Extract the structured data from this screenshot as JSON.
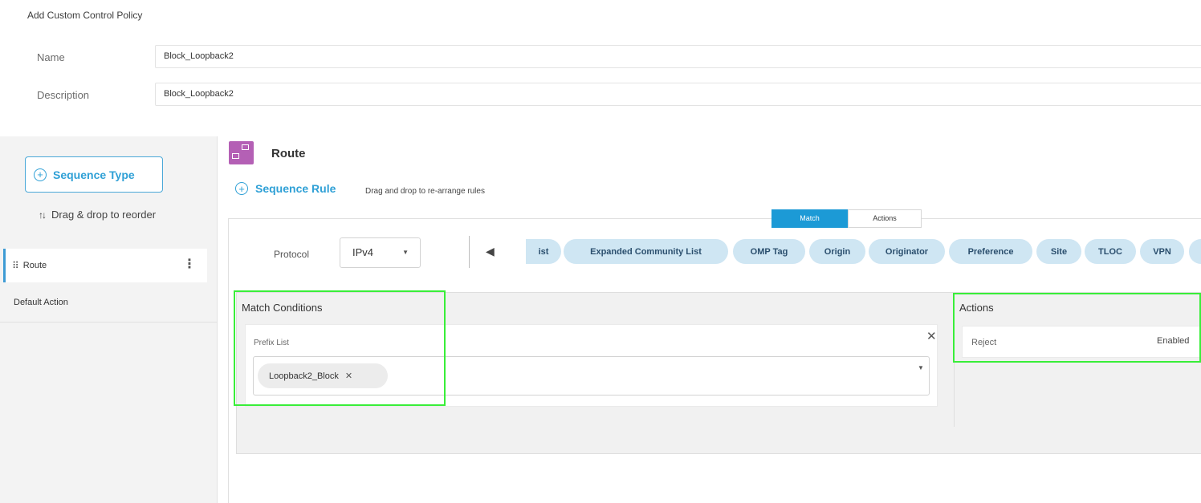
{
  "page": {
    "title": "Add Custom Control Policy"
  },
  "form": {
    "name_label": "Name",
    "name_value": "Block_Loopback2",
    "description_label": "Description",
    "description_value": "Block_Loopback2"
  },
  "sidebar": {
    "sequence_type_label": "Sequence Type",
    "drag_reorder_label": "Drag & drop to reorder",
    "items": [
      {
        "label": "Route"
      }
    ],
    "default_action_label": "Default Action"
  },
  "main": {
    "title": "Route",
    "sequence_rule_label": "Sequence Rule",
    "sequence_rule_hint": "Drag and drop to re-arrange rules",
    "tabs": [
      {
        "label": "Match"
      },
      {
        "label": "Actions"
      }
    ],
    "protocol_label": "Protocol",
    "protocol_value": "IPv4",
    "match_chips": [
      "ist",
      "Expanded Community List",
      "OMP Tag",
      "Origin",
      "Originator",
      "Preference",
      "Site",
      "TLOC",
      "VPN"
    ],
    "match_conditions": {
      "title": "Match Conditions",
      "prefix_list_label": "Prefix List",
      "prefix_list_values": [
        "Loopback2_Block"
      ]
    },
    "actions": {
      "title": "Actions",
      "reject_label": "Reject",
      "reject_value": "Enabled"
    }
  },
  "colors": {
    "accent": "#1c9ad6",
    "chip_bg": "#cfe6f3",
    "highlight": "#39ee39",
    "route_icon": "#b460b5"
  }
}
